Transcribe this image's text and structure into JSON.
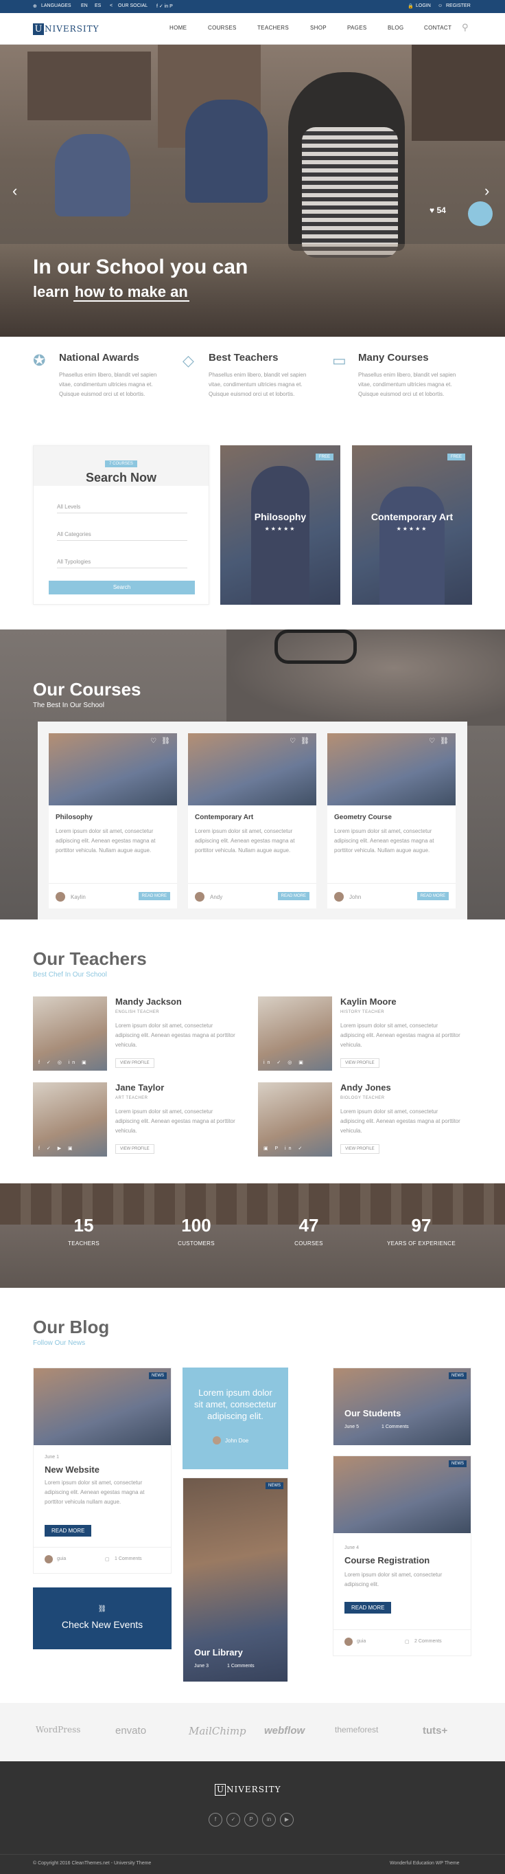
{
  "topbar": {
    "languages": "LANGUAGES",
    "en": "EN",
    "es": "ES",
    "our_social": "OUR SOCIAL",
    "social_icons": "f ✓ in P",
    "login": "LOGIN",
    "register": "REGISTER"
  },
  "logo": {
    "u": "U",
    "rest": "NIVERSITY"
  },
  "nav": [
    "HOME",
    "COURSES",
    "TEACHERS",
    "SHOP",
    "PAGES",
    "BLOG",
    "CONTACT"
  ],
  "hero": {
    "title": "In our School you can",
    "sub_prefix": "learn",
    "sub_highlight": "how to make an",
    "counter": "54"
  },
  "features": [
    {
      "title": "National Awards",
      "text": "Phasellus enim libero, blandit vel sapien vitae, condimentum ultricies magna et. Quisque euismod orci ut et lobortis."
    },
    {
      "title": "Best Teachers",
      "text": "Phasellus enim libero, blandit vel sapien vitae, condimentum ultricies magna et. Quisque euismod orci ut et lobortis."
    },
    {
      "title": "Many Courses",
      "text": "Phasellus enim libero, blandit vel sapien vitae, condimentum ultricies magna et. Quisque euismod orci ut et lobortis."
    }
  ],
  "search": {
    "badge": "7 COURSES",
    "title": "Search Now",
    "field1": "All Levels",
    "field2": "All Categories",
    "field3": "All Typologies",
    "button": "Search"
  },
  "featured_courses": [
    {
      "badge": "FREE",
      "title": "Philosophy",
      "stars": "★★★★★"
    },
    {
      "badge": "FREE",
      "title": "Contemporary Art",
      "stars": "★★★★★"
    }
  ],
  "our_courses": {
    "title": "Our Courses",
    "subtitle": "The Best In Our School",
    "cards": [
      {
        "title": "Philosophy",
        "text": "Lorem ipsum dolor sit amet, consectetur adipiscing elit. Aenean egestas magna at porttitor vehicula. Nullam augue augue.",
        "author": "Kaylin",
        "button": "READ MORE"
      },
      {
        "title": "Contemporary Art",
        "text": "Lorem ipsum dolor sit amet, consectetur adipiscing elit. Aenean egestas magna at porttitor vehicula. Nullam augue augue.",
        "author": "Andy",
        "button": "READ MORE"
      },
      {
        "title": "Geometry Course",
        "text": "Lorem ipsum dolor sit amet, consectetur adipiscing elit. Aenean egestas magna at porttitor vehicula. Nullam augue augue.",
        "author": "John",
        "button": "READ MORE"
      }
    ]
  },
  "teachers": {
    "title": "Our Teachers",
    "subtitle": "Best Chef In Our School",
    "items": [
      {
        "name": "Mandy Jackson",
        "role": "ENGLISH TEACHER",
        "text": "Lorem ipsum dolor sit amet, consectetur adipiscing elit. Aenean egestas magna at porttitor vehicula.",
        "button": "VIEW PROFILE"
      },
      {
        "name": "Kaylin Moore",
        "role": "HISTORY TEACHER",
        "text": "Lorem ipsum dolor sit amet, consectetur adipiscing elit. Aenean egestas magna at porttitor vehicula.",
        "button": "VIEW PROFILE"
      },
      {
        "name": "Jane Taylor",
        "role": "ART TEACHER",
        "text": "Lorem ipsum dolor sit amet, consectetur adipiscing elit. Aenean egestas magna at porttitor vehicula.",
        "button": "VIEW PROFILE"
      },
      {
        "name": "Andy Jones",
        "role": "BIOLOGY TEACHER",
        "text": "Lorem ipsum dolor sit amet, consectetur adipiscing elit. Aenean egestas magna at porttitor vehicula.",
        "button": "VIEW PROFILE"
      }
    ]
  },
  "stats": [
    {
      "number": "15",
      "label": "TEACHERS"
    },
    {
      "number": "100",
      "label": "CUSTOMERS"
    },
    {
      "number": "47",
      "label": "COURSES"
    },
    {
      "number": "97",
      "label": "YEARS OF EXPERIENCE"
    }
  ],
  "blog": {
    "title": "Our Blog",
    "subtitle": "Follow Our News",
    "post1": {
      "badge": "NEWS",
      "date": "June 1",
      "title": "New Website",
      "text": "Lorem ipsum dolor sit amet, consectetur adipiscing elit. Aenean egestas magna at porttitor vehicula nullam augue.",
      "button": "READ MORE",
      "author": "guia",
      "comments": "1 Comments"
    },
    "quote": {
      "text": "Lorem ipsum dolor sit amet, consectetur adipiscing elit.",
      "author": "John Doe"
    },
    "post2": {
      "badge": "NEWS",
      "title": "Our Students",
      "date": "June 5",
      "comments": "1 Comments"
    },
    "post3": {
      "badge": "NEWS",
      "date": "June 4",
      "title": "Course Registration",
      "text": "Lorem ipsum dolor sit amet, consectetur adipiscing elit.",
      "button": "READ MORE",
      "author": "guia",
      "comments": "2 Comments"
    },
    "post4": {
      "badge": "NEWS",
      "title": "Our Library",
      "date": "June 3",
      "comments": "1 Comments"
    },
    "events": "Check New Events"
  },
  "partners": [
    "WordPress",
    "envato",
    "MailChimp",
    "webflow",
    "themeforest",
    "tuts+"
  ],
  "footer": {
    "logo_u": "U",
    "logo_rest": "NIVERSITY",
    "copyright": "© Copyright 2016 CleanThemes.net - University Theme",
    "tagline": "Wonderful Education WP Theme"
  },
  "colors": {
    "navy": "#1e4876",
    "light_blue": "#8dc6df",
    "footer": "#333333"
  }
}
